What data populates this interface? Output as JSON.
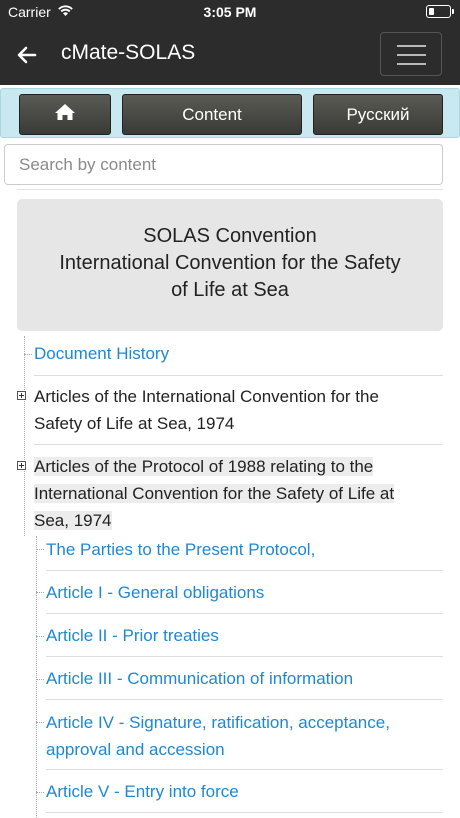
{
  "status_bar": {
    "carrier": "Carrier",
    "time": "3:05 PM"
  },
  "navbar": {
    "title": "cMate-SOLAS",
    "back_icon": "arrow-left-icon",
    "menu_icon": "hamburger-icon"
  },
  "buttons": {
    "home_icon": "home-icon",
    "content_label": "Content",
    "language_label": "Русский"
  },
  "search": {
    "placeholder": "Search by content"
  },
  "header": {
    "line1": "SOLAS Convention",
    "line2": "International Convention for the Safety",
    "line3": "of Life at Sea"
  },
  "tree": {
    "document_history": "Document History",
    "articles_1974": {
      "line1": "Articles of the International Convention for the",
      "line2": "Safety of Life at Sea, 1974"
    },
    "articles_1988": {
      "line1": "Articles of the Protocol of 1988 relating to the",
      "line2": "International Convention for the Safety of Life at",
      "line3": "Sea, 1974"
    },
    "children": {
      "parties": "The Parties to the Present Protocol,",
      "article_1": "Article I - General obligations",
      "article_2": "Article II - Prior treaties",
      "article_3": "Article III - Communication of information",
      "article_4_line1": "Article IV - Signature, ratification, acceptance,",
      "article_4_line2": "approval and accession",
      "article_5": "Article V - Entry into force"
    }
  },
  "colors": {
    "navbar_bg": "#2c2c2c",
    "button_bar_bg": "#c9e8ef",
    "link": "#1e88d4",
    "header_bg": "#e6e6e6"
  }
}
